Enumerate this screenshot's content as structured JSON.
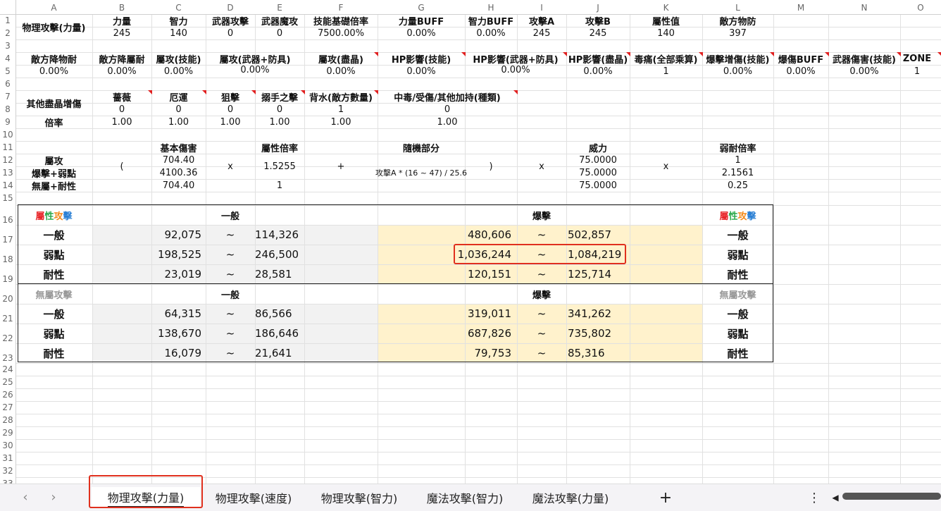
{
  "columns": [
    "A",
    "B",
    "C",
    "D",
    "E",
    "F",
    "G",
    "H",
    "I",
    "J",
    "K",
    "L",
    "M",
    "N",
    "O"
  ],
  "rows": [
    "1",
    "2",
    "3",
    "4",
    "5",
    "6",
    "7",
    "8",
    "9",
    "10",
    "11",
    "12",
    "13",
    "14",
    "15",
    "16",
    "17",
    "18",
    "19",
    "20",
    "21",
    "22",
    "23",
    "24",
    "25",
    "26",
    "27",
    "28",
    "29",
    "30",
    "31",
    "32",
    "33"
  ],
  "r1": {
    "a": "物理攻擊(力量)",
    "b": "力量",
    "c": "智力",
    "d": "武器攻擊",
    "e": "武器魔攻",
    "f": "技能基礎倍率",
    "g": "力量BUFF",
    "h": "智力BUFF",
    "i": "攻擊A",
    "j": "攻擊B",
    "k": "屬性值",
    "l": "敵方物防"
  },
  "r2": {
    "b": "245",
    "c": "140",
    "d": "0",
    "e": "0",
    "f": "7500.00%",
    "g": "0.00%",
    "h": "0.00%",
    "i": "245",
    "j": "245",
    "k": "140",
    "l": "397"
  },
  "r4": {
    "a": "敵方降物耐",
    "b": "敵方降屬耐",
    "c": "屬攻(技能)",
    "de": "屬攻(武器+防具)",
    "f": "屬攻(盡晶)",
    "g": "HP影響(技能)",
    "hi": "HP影響(武器+防具)",
    "j": "HP影響(盡晶)",
    "k": "毒痛(全部乘算)",
    "l": "爆擊增傷(技能)",
    "m": "爆傷BUFF",
    "n": "武器傷害(技能)",
    "o": "ZONE"
  },
  "r5": {
    "a": "0.00%",
    "b": "0.00%",
    "c": "0.00%",
    "de": "0.00%",
    "f": "0.00%",
    "g": "0.00%",
    "hi": "0.00%",
    "j": "0.00%",
    "k": "1",
    "l": "0.00%",
    "m": "0.00%",
    "n": "0.00%",
    "o": "1"
  },
  "r7": {
    "a": "其他盡晶增傷",
    "b": "薔薇",
    "c": "厄運",
    "d": "狙擊",
    "e": "搦手之擊",
    "f": "背水(敵方數量)",
    "g": "中毒/受傷/其他加持(種類)"
  },
  "r8": {
    "b": "0",
    "c": "0",
    "d": "0",
    "e": "0",
    "f": "1",
    "g": "0"
  },
  "r9": {
    "a": "倍率",
    "b": "1.00",
    "c": "1.00",
    "d": "1.00",
    "e": "1.00",
    "f": "1.00",
    "g": "1.00"
  },
  "formula": {
    "c11": "基本傷害",
    "e11": "屬性倍率",
    "g11": "隨機部分",
    "j11": "威力",
    "l11": "弱耐倍率",
    "a12": "屬攻",
    "a13": "爆擊+弱點",
    "a14": "無屬+耐性",
    "paren_open": "(",
    "paren_close": ")",
    "x1": "x",
    "x2": "x",
    "x3": "x",
    "plus": "+",
    "c12": "704.40",
    "c13": "4100.36",
    "c14": "704.40",
    "e12": "1.5255",
    "e14": "1",
    "g13": "攻擊A * (16 ~ 47) / 25.6",
    "j12": "75.0000",
    "j13": "75.0000",
    "j14": "75.0000",
    "l12": "1",
    "l13": "2.1561",
    "l14": "0.25"
  },
  "attr": {
    "title_chars": [
      "屬",
      "性",
      "攻",
      "擊"
    ],
    "normal": "一般",
    "crit": "爆擊",
    "rows": [
      {
        "label": "一般",
        "n_min": "92,075",
        "n_max": "114,326",
        "c_min": "480,606",
        "c_max": "502,857",
        "tilde": "~"
      },
      {
        "label": "弱點",
        "n_min": "198,525",
        "n_max": "246,500",
        "c_min": "1,036,244",
        "c_max": "1,084,219",
        "tilde": "~"
      },
      {
        "label": "耐性",
        "n_min": "23,019",
        "n_max": "28,581",
        "c_min": "120,151",
        "c_max": "125,714",
        "tilde": "~"
      }
    ]
  },
  "none": {
    "title": "無屬攻擊",
    "normal": "一般",
    "crit": "爆擊",
    "rows": [
      {
        "label": "一般",
        "n_min": "64,315",
        "n_max": "86,566",
        "c_min": "319,011",
        "c_max": "341,262",
        "tilde": "~"
      },
      {
        "label": "弱點",
        "n_min": "138,670",
        "n_max": "186,646",
        "c_min": "687,826",
        "c_max": "735,802",
        "tilde": "~"
      },
      {
        "label": "耐性",
        "n_min": "16,079",
        "n_max": "21,641",
        "c_min": "79,753",
        "c_max": "85,316",
        "tilde": "~"
      }
    ]
  },
  "colors": {
    "red": "#e8262a",
    "green": "#2aa84a",
    "orange": "#f28a1c",
    "blue": "#2a7fd4",
    "gray": "#999999",
    "normal_fill": "#f2f2f2",
    "crit_fill": "#fff2cc"
  },
  "tabs": {
    "t1": "物理攻擊(力量)",
    "t2": "物理攻擊(速度)",
    "t3": "物理攻擊(智力)",
    "t4": "魔法攻擊(智力)",
    "t5": "魔法攻擊(力量)",
    "add": "+",
    "more": "⋮",
    "prev": "‹",
    "next": "›",
    "scroll_left": "◀"
  }
}
